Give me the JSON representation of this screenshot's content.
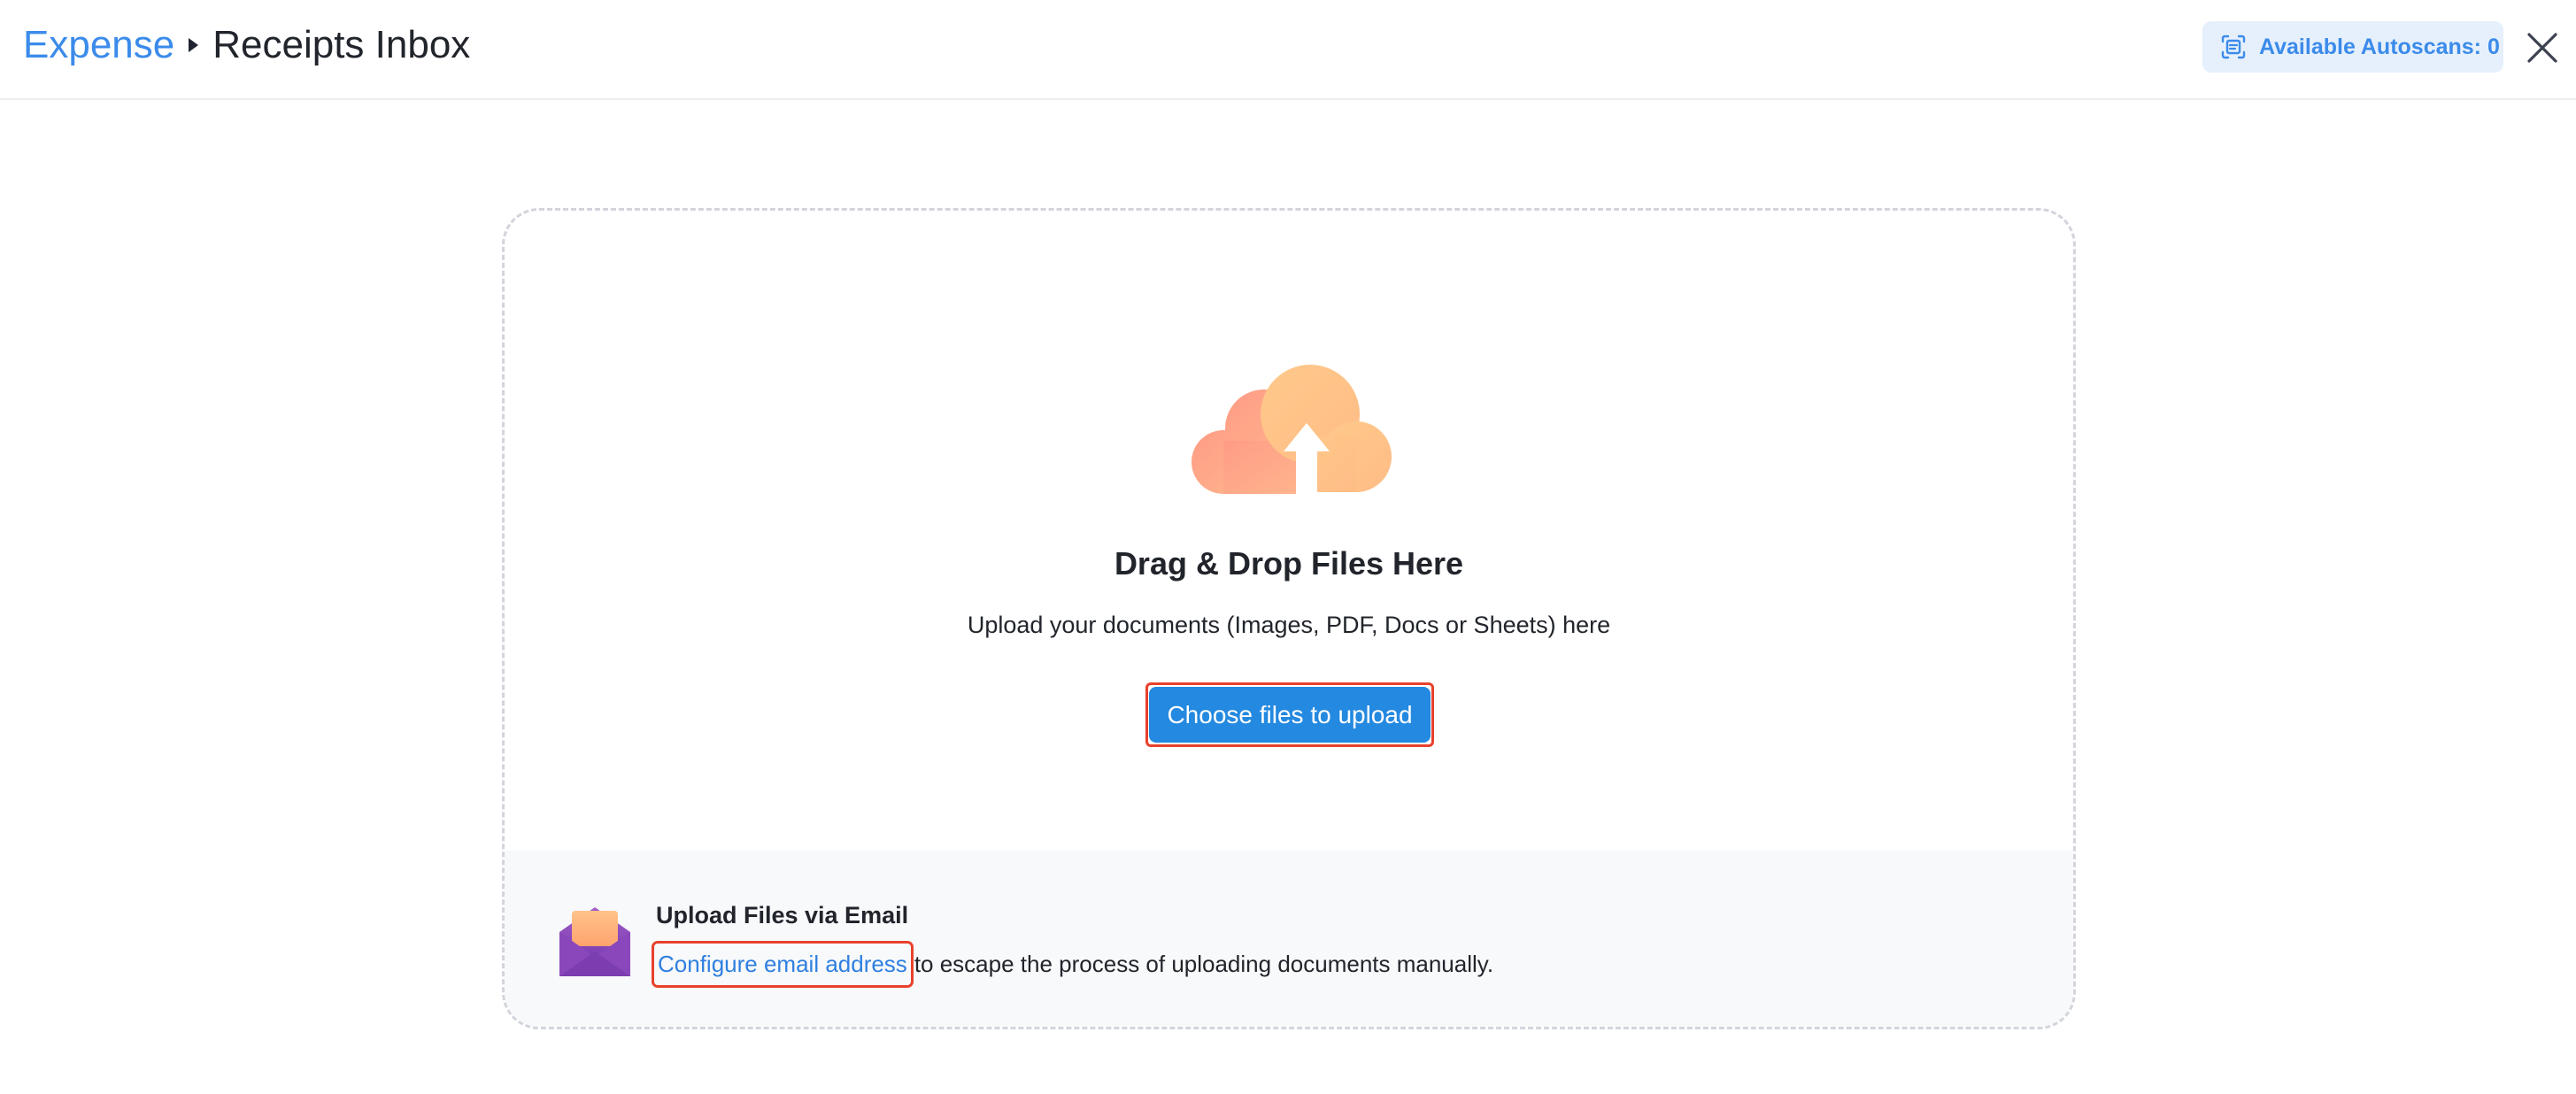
{
  "header": {
    "breadcrumb": {
      "parent": "Expense",
      "current": "Receipts Inbox"
    },
    "autoscans": {
      "label": "Available Autoscans: 0",
      "icon": "scan-icon"
    },
    "close_icon": "close-icon"
  },
  "upload": {
    "icon": "cloud-upload-icon",
    "title": "Drag & Drop Files Here",
    "subtitle": "Upload your documents (Images, PDF, Docs or Sheets) here",
    "button_label": "Choose files to upload"
  },
  "email": {
    "icon": "envelope-icon",
    "title": "Upload Files via Email",
    "link_text": "Configure email address",
    "rest_text": "to escape the process of uploading documents manually."
  },
  "colors": {
    "accent": "#3b8bea",
    "button": "#2489e0",
    "highlight": "#e8412c",
    "cloud_left": "#ffa48a",
    "cloud_right": "#ffcb8a"
  }
}
